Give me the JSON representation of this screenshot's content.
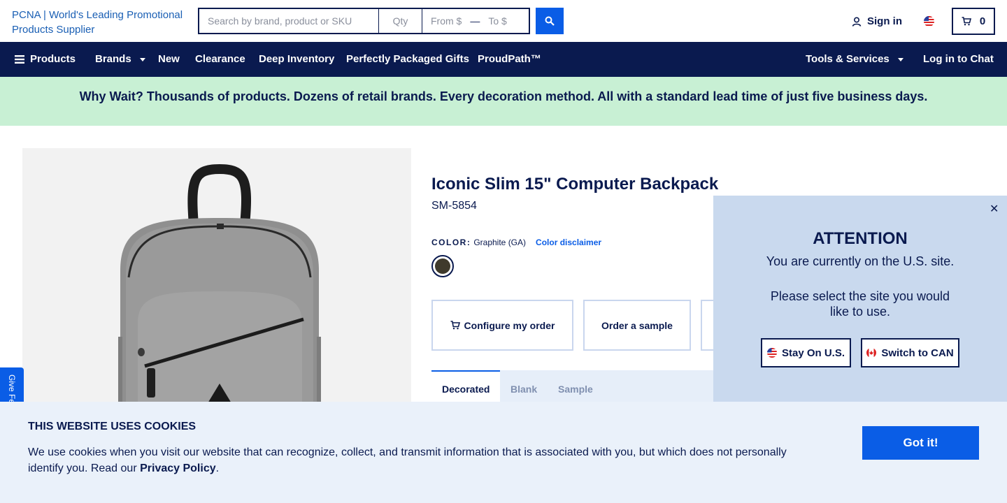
{
  "header": {
    "logo_alt": "PCNA | World's Leading Promotional Products Supplier",
    "search_placeholder": "Search by brand, product or SKU",
    "qty_placeholder": "Qty",
    "from_placeholder": "From $",
    "range_separator": "—",
    "to_placeholder": "To $",
    "signin_label": "Sign in",
    "cart_count": "0"
  },
  "nav": {
    "items": [
      {
        "label": "Products"
      },
      {
        "label": "Brands"
      },
      {
        "label": "New"
      },
      {
        "label": "Clearance"
      },
      {
        "label": "Deep Inventory"
      },
      {
        "label": "Perfectly Packaged Gifts"
      },
      {
        "label": "ProudPath™"
      }
    ],
    "tools_label": "Tools & Services",
    "chat_label": "Log in to Chat"
  },
  "banner": {
    "text": "Why Wait? Thousands of products. Dozens of retail brands. Every decoration method. All with a standard lead time of just five business days."
  },
  "product": {
    "title": "Iconic Slim 15\" Computer Backpack",
    "sku": "SM-5854",
    "color_label": "COLOR:",
    "color_value": "Graphite (GA)",
    "color_disclaimer": "Color disclaimer",
    "swatch_color": "#3f3a2c",
    "actions": {
      "configure": "Configure my order",
      "sample": "Order a sample"
    },
    "tabs": [
      {
        "label": "Decorated"
      },
      {
        "label": "Blank"
      },
      {
        "label": "Sample"
      }
    ]
  },
  "feedback": {
    "label": "Give Feedback"
  },
  "attention": {
    "title": "ATTENTION",
    "line1": "You are currently on the U.S. site.",
    "line2": "Please select the site you would like to use.",
    "stay_label": "Stay On U.S.",
    "switch_label": "Switch to CAN"
  },
  "cookies": {
    "title": "This website uses cookies",
    "text": "We use cookies when you visit our website that can recognize, collect, and transmit information that is associated with you, but which does not personally identify you. Read our ",
    "link": "Privacy Policy",
    "end": ".",
    "button": "Got it!"
  },
  "colors": {
    "navy": "#0a1a4f",
    "accent_blue": "#0a5de6",
    "banner_green": "#c8f0d4",
    "popup_bg": "#c9d9ee",
    "cookie_bg": "#eaf1fa"
  }
}
